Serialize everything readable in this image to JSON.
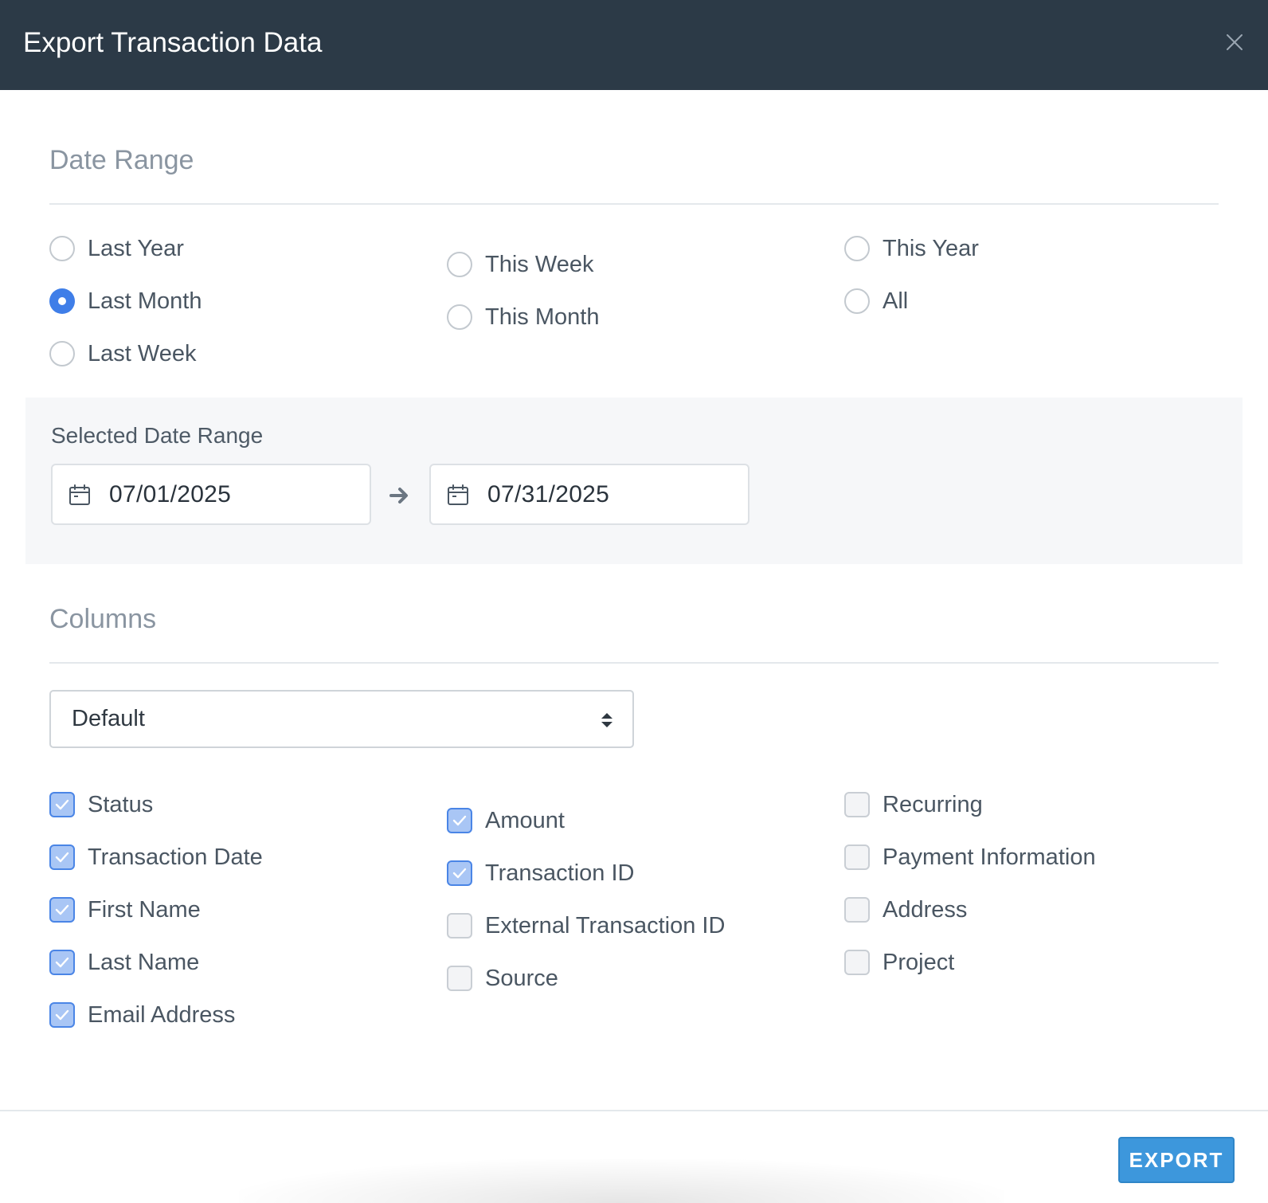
{
  "dialog": {
    "title": "Export Transaction Data",
    "close_icon": "close-icon"
  },
  "date_range": {
    "heading": "Date Range",
    "options": [
      {
        "label": "Last Year",
        "checked": false
      },
      {
        "label": "Last Month",
        "checked": true
      },
      {
        "label": "Last Week",
        "checked": false
      },
      {
        "label": "This Week",
        "checked": false
      },
      {
        "label": "This Month",
        "checked": false
      },
      {
        "label": "This Year",
        "checked": false
      },
      {
        "label": "All",
        "checked": false
      }
    ],
    "selected_heading": "Selected Date Range",
    "start_date": "07/01/2025",
    "end_date": "07/31/2025",
    "icons": {
      "calendar": "calendar-icon",
      "arrow": "arrow-right-icon"
    }
  },
  "columns": {
    "heading": "Columns",
    "preset_selected": "Default",
    "items": [
      {
        "label": "Status",
        "checked": true
      },
      {
        "label": "Transaction Date",
        "checked": true
      },
      {
        "label": "First Name",
        "checked": true
      },
      {
        "label": "Last Name",
        "checked": true
      },
      {
        "label": "Email Address",
        "checked": true
      },
      {
        "label": "Amount",
        "checked": true
      },
      {
        "label": "Transaction ID",
        "checked": true
      },
      {
        "label": "External Transaction ID",
        "checked": false
      },
      {
        "label": "Source",
        "checked": false
      },
      {
        "label": "Recurring",
        "checked": false
      },
      {
        "label": "Payment Information",
        "checked": false
      },
      {
        "label": "Address",
        "checked": false
      },
      {
        "label": "Project",
        "checked": false
      }
    ]
  },
  "footer": {
    "export_label": "EXPORT"
  },
  "colors": {
    "header_bg": "#2c3a47",
    "accent": "#3f7ee8",
    "export_button": "#3d97dc"
  }
}
